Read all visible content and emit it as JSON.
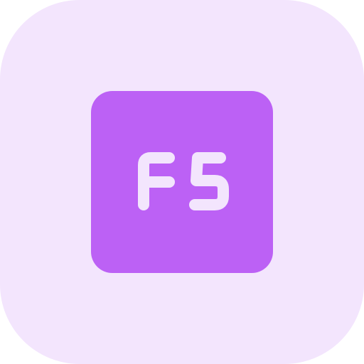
{
  "icon": {
    "key_label": "F5",
    "name": "function-key-f5-icon",
    "colors": {
      "background": "#F3E5FD",
      "key": "#BC61F5",
      "glyph": "#F3E5FD"
    }
  }
}
